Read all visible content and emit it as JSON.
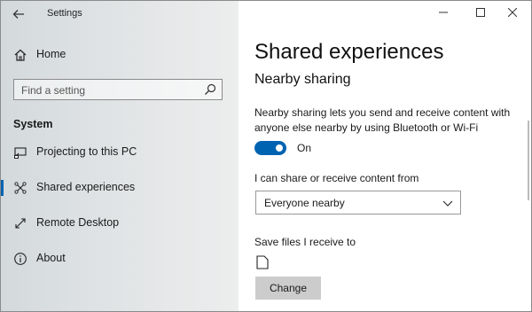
{
  "window": {
    "app_title": "Settings"
  },
  "sidebar": {
    "home_label": "Home",
    "search_placeholder": "Find a setting",
    "section": "System",
    "items": [
      {
        "label": "Projecting to this PC",
        "icon": "projector-icon",
        "selected": false
      },
      {
        "label": "Shared experiences",
        "icon": "shared-experiences-icon",
        "selected": true
      },
      {
        "label": "Remote Desktop",
        "icon": "remote-desktop-icon",
        "selected": false
      },
      {
        "label": "About",
        "icon": "info-icon",
        "selected": false
      }
    ]
  },
  "main": {
    "title": "Shared experiences",
    "subtitle": "Nearby sharing",
    "description": "Nearby sharing lets you send and receive content with anyone else nearby by using Bluetooth or Wi-Fi",
    "toggle": {
      "state": "On",
      "on": true
    },
    "share_from_label": "I can share or receive content from",
    "share_from_value": "Everyone nearby",
    "save_label": "Save files I receive to",
    "change_label": "Change"
  },
  "colors": {
    "accent": "#0063b1"
  }
}
